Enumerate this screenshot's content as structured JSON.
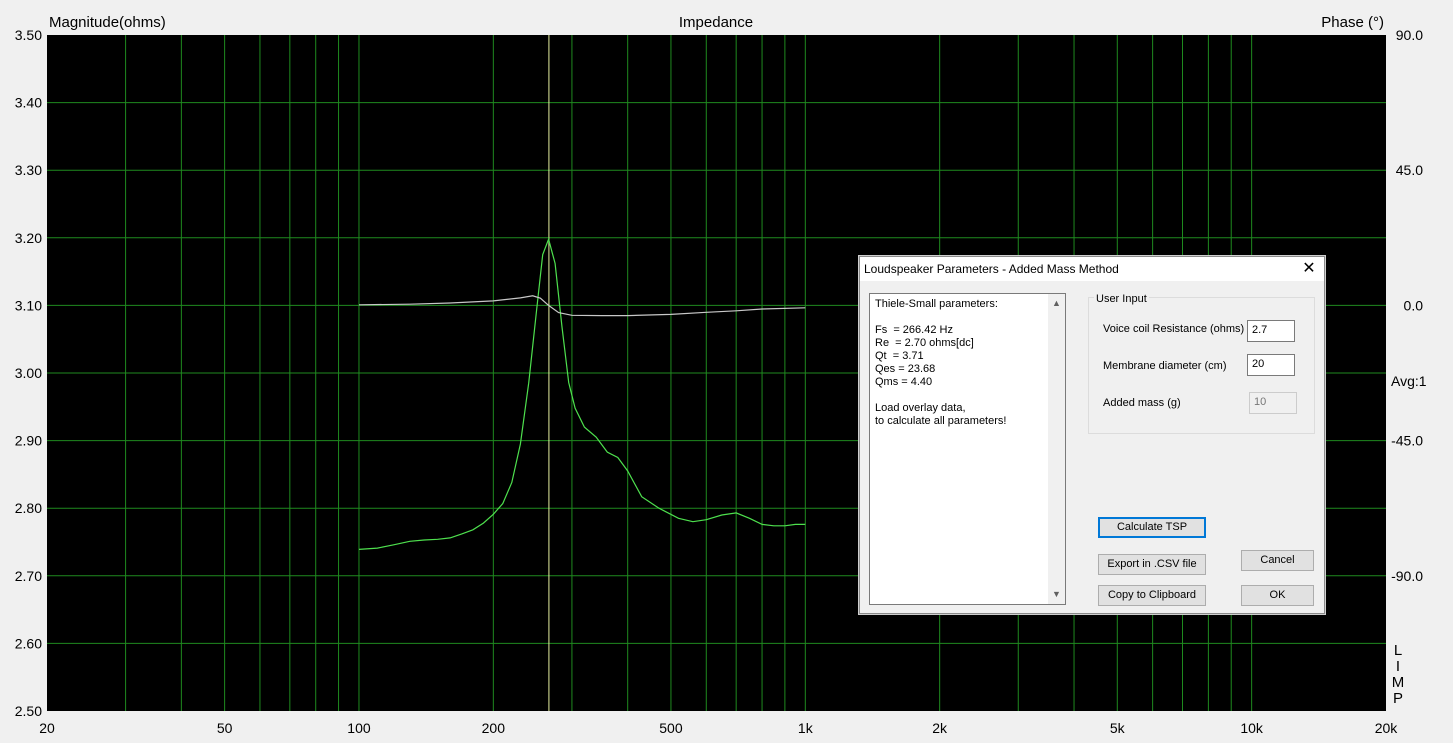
{
  "chart_data": {
    "type": "line",
    "title": "Impedance",
    "ylabel_left": "Magnitude(ohms)",
    "ylabel_right": "Phase (°)",
    "x_scale": "log",
    "xlim": [
      20,
      20000
    ],
    "ylim_left": [
      2.5,
      3.5
    ],
    "ylim_right": [
      -135,
      90
    ],
    "x_ticks": [
      {
        "value": 20,
        "label": "20"
      },
      {
        "value": 50,
        "label": "50"
      },
      {
        "value": 100,
        "label": "100"
      },
      {
        "value": 200,
        "label": "200"
      },
      {
        "value": 500,
        "label": "500"
      },
      {
        "value": 1000,
        "label": "1k"
      },
      {
        "value": 2000,
        "label": "2k"
      },
      {
        "value": 5000,
        "label": "5k"
      },
      {
        "value": 10000,
        "label": "10k"
      },
      {
        "value": 20000,
        "label": "20k"
      }
    ],
    "y_ticks_left": [
      "3.50",
      "3.40",
      "3.30",
      "3.20",
      "3.10",
      "3.00",
      "2.90",
      "2.80",
      "2.70",
      "2.60",
      "2.50"
    ],
    "y_ticks_right": [
      {
        "value": 90,
        "label": "90.0"
      },
      {
        "value": 45,
        "label": "45.0"
      },
      {
        "value": 0,
        "label": "0.0"
      },
      {
        "value": -45,
        "label": "-45.0"
      },
      {
        "value": -90,
        "label": "-90.0"
      }
    ],
    "grid": true,
    "cursor_x": 266.42,
    "avg_label": "Avg:1",
    "limp_letters": [
      "L",
      "I",
      "M",
      "P"
    ],
    "colors": {
      "background": "#000000",
      "grid": "#1f8a1f",
      "magnitude": "#4ee04e",
      "phase": "#c8c8c8",
      "cursor": "#e6f0a0"
    },
    "series": [
      {
        "axis": "left",
        "points": [
          [
            100,
            2.739
          ],
          [
            110,
            2.741
          ],
          [
            120,
            2.746
          ],
          [
            130,
            2.751
          ],
          [
            140,
            2.753
          ],
          [
            150,
            2.754
          ],
          [
            160,
            2.756
          ],
          [
            170,
            2.762
          ],
          [
            180,
            2.768
          ],
          [
            190,
            2.778
          ],
          [
            200,
            2.791
          ],
          [
            210,
            2.807
          ],
          [
            220,
            2.838
          ],
          [
            230,
            2.895
          ],
          [
            240,
            2.985
          ],
          [
            250,
            3.093
          ],
          [
            258,
            3.175
          ],
          [
            266,
            3.198
          ],
          [
            275,
            3.162
          ],
          [
            285,
            3.068
          ],
          [
            295,
            2.986
          ],
          [
            305,
            2.948
          ],
          [
            320,
            2.92
          ],
          [
            340,
            2.905
          ],
          [
            360,
            2.883
          ],
          [
            380,
            2.875
          ],
          [
            400,
            2.855
          ],
          [
            430,
            2.817
          ],
          [
            470,
            2.8
          ],
          [
            520,
            2.785
          ],
          [
            560,
            2.78
          ],
          [
            600,
            2.783
          ],
          [
            650,
            2.79
          ],
          [
            700,
            2.793
          ],
          [
            750,
            2.785
          ],
          [
            800,
            2.776
          ],
          [
            850,
            2.774
          ],
          [
            900,
            2.774
          ],
          [
            950,
            2.776
          ],
          [
            1000,
            2.776
          ]
        ]
      },
      {
        "axis": "right",
        "points": [
          [
            100,
            0.2
          ],
          [
            130,
            0.4
          ],
          [
            160,
            0.8
          ],
          [
            200,
            1.5
          ],
          [
            230,
            2.5
          ],
          [
            245,
            3.2
          ],
          [
            255,
            2.4
          ],
          [
            266,
            0
          ],
          [
            280,
            -2.4
          ],
          [
            300,
            -3.3
          ],
          [
            350,
            -3.4
          ],
          [
            400,
            -3.4
          ],
          [
            500,
            -3.0
          ],
          [
            600,
            -2.3
          ],
          [
            700,
            -1.8
          ],
          [
            800,
            -1.2
          ],
          [
            1000,
            -0.8
          ]
        ]
      }
    ]
  },
  "dialog": {
    "title": "Loudspeaker Parameters - Added Mass Method",
    "close_glyph": "✕",
    "ts_text": "Thiele-Small parameters:\n\nFs  = 266.42 Hz\nRe  = 2.70 ohms[dc]\nQt  = 3.71\nQes = 23.68\nQms = 4.40\n\nLoad overlay data,\nto calculate all parameters!",
    "scroll_up": "▲",
    "scroll_down": "▼",
    "user_input_label": "User Input",
    "voice_coil_label": "Voice coil Resistance (ohms)",
    "voice_coil_value": "2.7",
    "membrane_label": "Membrane diameter (cm)",
    "membrane_value": "20",
    "added_mass_label": "Added mass (g)",
    "added_mass_value": "10",
    "calculate_label": "Calculate TSP",
    "export_label": "Export in .CSV file",
    "copy_label": "Copy to Clipboard",
    "cancel_label": "Cancel",
    "ok_label": "OK"
  }
}
